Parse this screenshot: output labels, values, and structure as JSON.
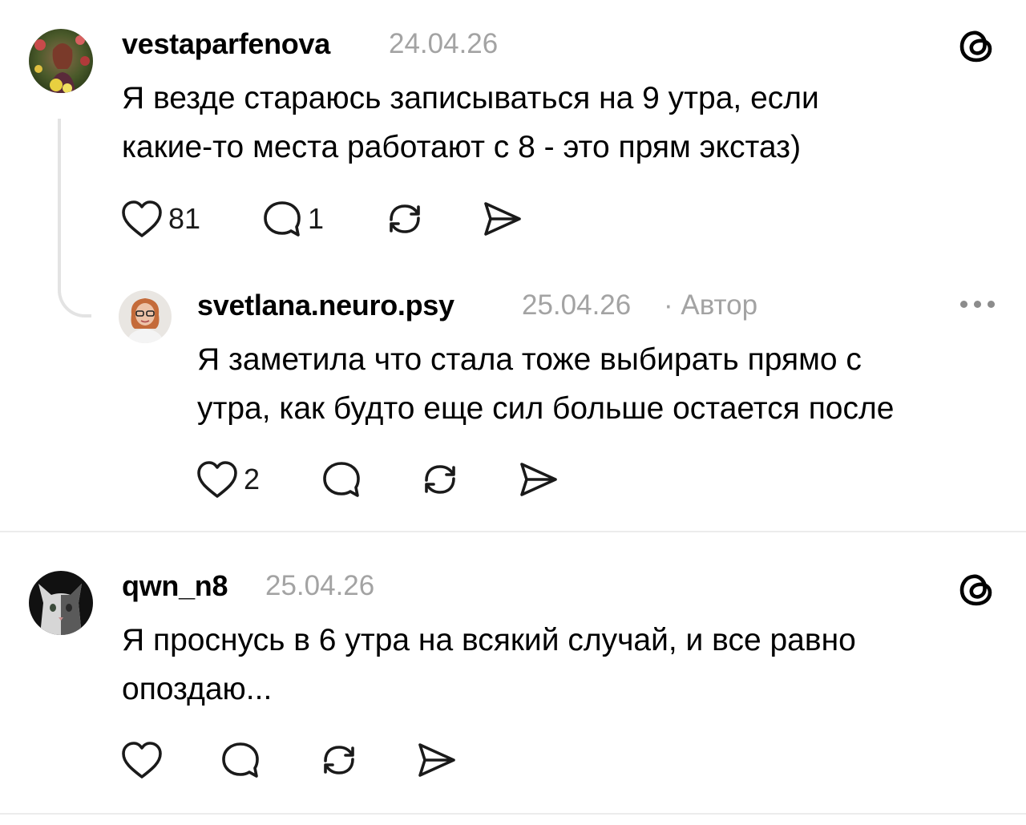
{
  "comments": [
    {
      "username": "vestaparfenova",
      "date": "24.04.26",
      "text_lines": [
        "Я везде стараюсь записываться на 9 утра, если",
        "какие-то места работают с 8 - это прям экстаз)"
      ],
      "likes": "81",
      "replies": "1",
      "avatar_icon": "user-avatar-photo",
      "corner_icon": "threads-logo-icon"
    },
    {
      "username": "svetlana.neuro.psy",
      "date": "25.04.26",
      "author_badge": "· Автор",
      "text_lines": [
        "Я заметила что стала тоже выбирать прямо с",
        "утра, как будто еще сил больше остается после"
      ],
      "likes": "2",
      "avatar_icon": "user-avatar-photo",
      "corner_icon": "more-options-icon"
    },
    {
      "username": "qwn_n8",
      "date": "25.04.26",
      "text_lines": [
        "Я проснусь в 6 утра на всякий случай, и все равно",
        "опоздаю..."
      ],
      "avatar_icon": "cat-avatar-photo",
      "corner_icon": "threads-logo-icon"
    }
  ],
  "colors": {
    "text": "#000000",
    "meta": "#a3a3a3",
    "icon": "#1a1a1a",
    "thread_line": "#e3e3e3",
    "divider": "#ececec"
  }
}
